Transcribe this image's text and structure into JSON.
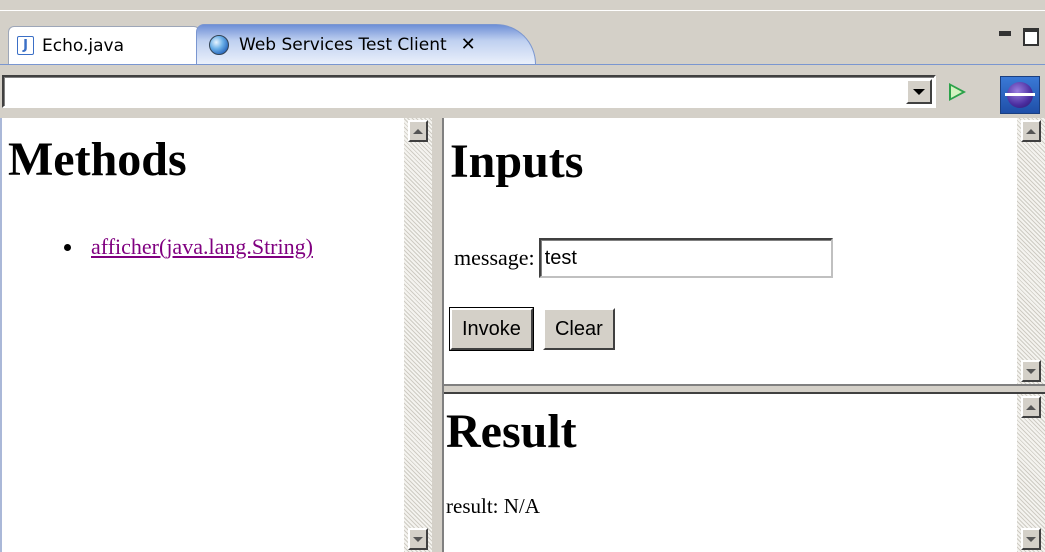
{
  "tabs": [
    {
      "label": "Echo.java",
      "icon": "java-file-icon",
      "active": false
    },
    {
      "label": "Web Services Test Client",
      "icon": "globe-icon",
      "active": true,
      "close": "✕"
    }
  ],
  "toolbar": {
    "url_value": ""
  },
  "methods": {
    "heading": "Methods",
    "items": [
      {
        "label": "afficher(java.lang.String)"
      }
    ]
  },
  "inputs": {
    "heading": "Inputs",
    "param_label": "message:",
    "param_value": "test",
    "invoke_label": "Invoke",
    "clear_label": "Clear"
  },
  "result": {
    "heading": "Result",
    "text": "result: N/A"
  },
  "colors": {
    "link": "#800080",
    "go": "#2ca24a",
    "tab_active": "#6e8fd6"
  }
}
